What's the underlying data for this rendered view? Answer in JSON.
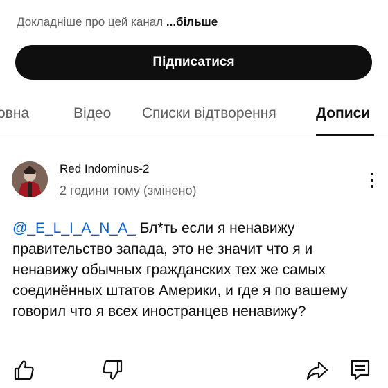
{
  "channel": {
    "about_text": "Докладніше про цей канал",
    "about_more": "...більше",
    "subscribe_label": "Підписатися"
  },
  "tabs": [
    {
      "label": "овна",
      "active": false
    },
    {
      "label": "Відео",
      "active": false
    },
    {
      "label": "Списки відтворення",
      "active": false
    },
    {
      "label": "Дописи",
      "active": true
    }
  ],
  "post": {
    "author": "Red Indominus-2",
    "time": "2 години тому (змінено)",
    "mention": "@_E_L_I_A_N_A_",
    "text": " Бл*ть если я ненавижу правительство запада, это не значит что я и ненавижу обычных гражданских тех же самых соединённых штатов Америки, и где я по вашему говорил что я всех иностранцев ненавижу?",
    "actions": [
      "like-icon",
      "dislike-icon",
      "share-icon",
      "comment-icon"
    ]
  },
  "colors": {
    "subscribe_bg": "#0f0f0f",
    "mention": "#065fd4",
    "secondary_text": "#606060"
  }
}
